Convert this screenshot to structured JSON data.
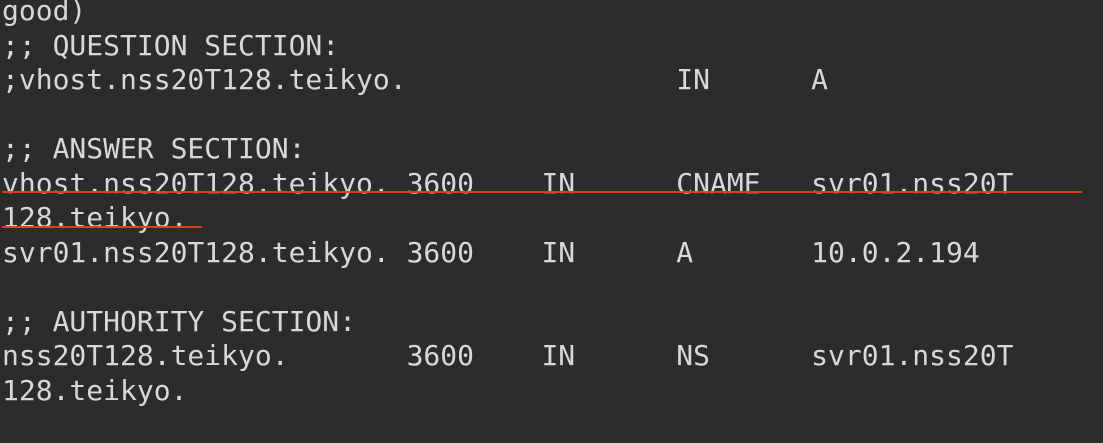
{
  "terminal": {
    "lines": [
      "good)",
      ";; QUESTION SECTION:",
      ";vhost.nss20T128.teikyo.                IN      A",
      "",
      ";; ANSWER SECTION:",
      "vhost.nss20T128.teikyo. 3600    IN      CNAME   svr01.nss20T",
      "128.teikyo.",
      "svr01.nss20T128.teikyo. 3600    IN      A       10.0.2.194",
      "",
      ";; AUTHORITY SECTION:",
      "nss20T128.teikyo.       3600    IN      NS      svr01.nss20T",
      "128.teikyo."
    ]
  },
  "annotation": {
    "underline_color": "#d9431f"
  }
}
